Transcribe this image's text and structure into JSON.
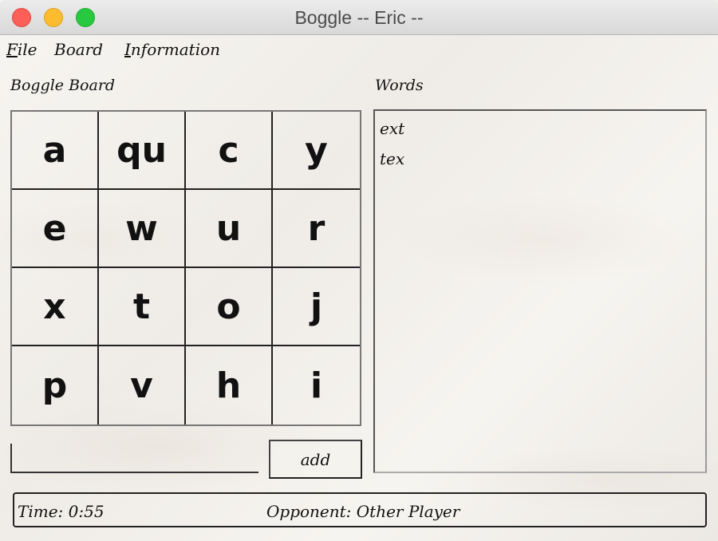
{
  "window": {
    "title": "Boggle -- Eric --"
  },
  "menu": [
    {
      "accel": "F",
      "rest": "ile"
    },
    {
      "accel": "",
      "rest": "Board"
    },
    {
      "accel": "I",
      "rest": "nformation"
    }
  ],
  "board": {
    "label": "Boggle Board",
    "cells": [
      "a",
      "qu",
      "c",
      "y",
      "e",
      "w",
      "u",
      "r",
      "x",
      "t",
      "o",
      "j",
      "p",
      "v",
      "h",
      "i"
    ]
  },
  "words": {
    "label": "Words",
    "items": [
      "ext",
      "tex"
    ]
  },
  "input": {
    "value": ""
  },
  "add_button": {
    "label": "add"
  },
  "status": {
    "time": "Time: 0:55",
    "opponent": "Opponent: Other Player"
  }
}
